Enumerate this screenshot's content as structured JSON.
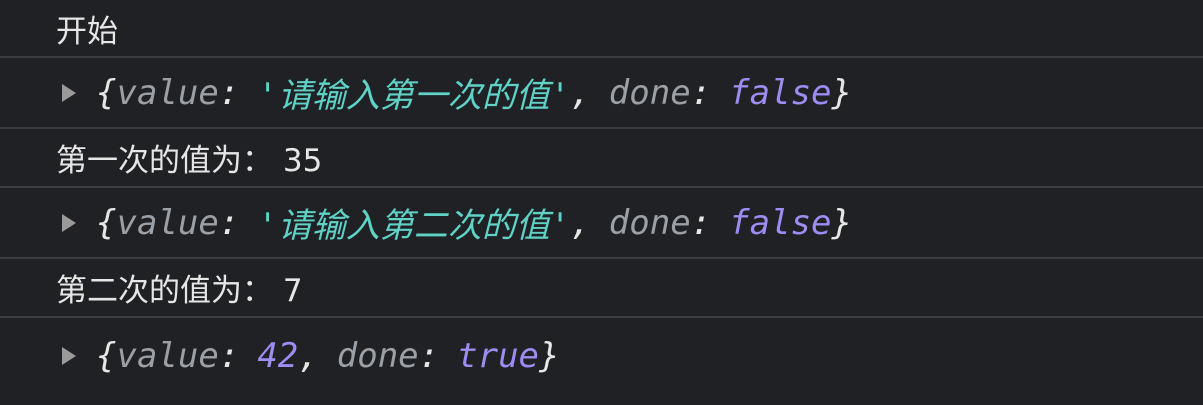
{
  "console": {
    "lines": [
      {
        "type": "log",
        "text": "开始"
      },
      {
        "type": "object",
        "value_key": "value",
        "value": "请输入第一次的值",
        "done_key": "done",
        "done": "false"
      },
      {
        "type": "log",
        "text": "第一次的值为： 35"
      },
      {
        "type": "object",
        "value_key": "value",
        "value": "请输入第二次的值",
        "done_key": "done",
        "done": "false"
      },
      {
        "type": "log",
        "text": "第二次的值为： 7"
      },
      {
        "type": "object",
        "value_key": "value",
        "value": "42",
        "done_key": "done",
        "done": "true"
      }
    ]
  },
  "colors": {
    "background": "#202124",
    "divider": "#3c3c3f",
    "string": "#5fd1c6",
    "keyword": "#9d8cf2",
    "key": "#9aa0a6"
  },
  "icons": {
    "expand": "disclosure-triangle-right-icon"
  }
}
